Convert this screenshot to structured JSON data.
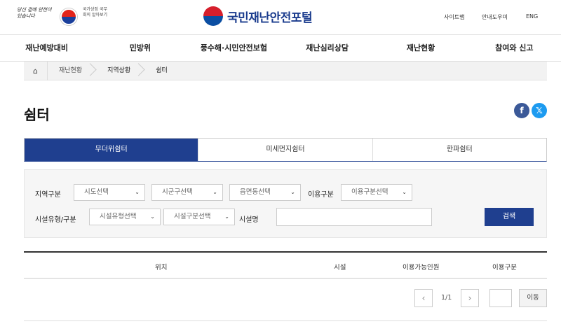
{
  "header": {
    "slogan": "당신 곁에 안전이 있습니다",
    "gov_text": "국가상징 국무회의 알아보기",
    "logo_text": "국민재난안전포털",
    "util": [
      "사이트맵",
      "안내도우미",
      "ENG"
    ]
  },
  "gnb": [
    "재난예방대비",
    "민방위",
    "풍수해·시민안전보험",
    "재난심리상담",
    "재난현황",
    "참여와 신고"
  ],
  "breadcrumb": [
    "재난현황",
    "지역상황",
    "쉼터"
  ],
  "page_title": "쉼터",
  "share": {
    "facebook": "f",
    "x": "𝕏"
  },
  "tabs": [
    "무더위쉼터",
    "미세먼지쉼터",
    "한파쉼터"
  ],
  "filter": {
    "region_label": "지역구분",
    "sido": "시도선택",
    "sigungu": "시군구선택",
    "eupmyeondong": "읍면동선택",
    "use_label": "이용구분",
    "use_select": "이용구분선택",
    "facility_type_label": "시설유형/구분",
    "facility_type": "시설유형선택",
    "facility_class": "시설구분선택",
    "facility_name_label": "시설명",
    "search_button": "검색"
  },
  "table": {
    "columns": [
      "위치",
      "시설",
      "이용가능인원",
      "이용구분"
    ]
  },
  "pagination": {
    "info": "1/1",
    "prev": "‹",
    "next": "›",
    "move": "이동"
  },
  "colors": {
    "primary": "#1f3f8f",
    "facebook": "#3b5998",
    "x": "#1d9bf0"
  }
}
